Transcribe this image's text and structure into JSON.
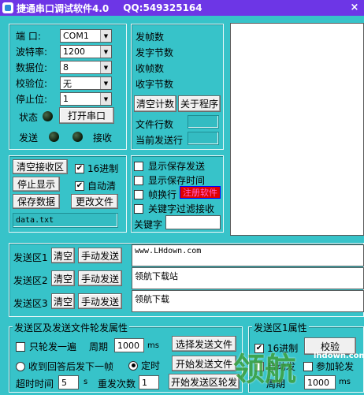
{
  "title": {
    "app_name": "捷通串口调试软件4.0",
    "qq": "QQ:549325164",
    "close_glyph": "×"
  },
  "port": {
    "port_label": "端    口:",
    "port_value": "COM1",
    "baud_label": "波特率:",
    "baud_value": "1200",
    "databits_label": "数据位:",
    "databits_value": "8",
    "parity_label": "校验位:",
    "parity_value": "无",
    "stopbits_label": "停止位:",
    "stopbits_value": "1",
    "status_label": "状态",
    "open_button": "打开串口",
    "send_label": "发送",
    "recv_label": "接收"
  },
  "stats": {
    "send_frames": "发帧数",
    "send_bytes": "发字节数",
    "recv_frames": "收帧数",
    "recv_bytes": "收字节数",
    "clear_count_button": "清空计数",
    "about_button": "关于程序",
    "file_lines_label": "文件行数",
    "current_line_label": "当前发送行"
  },
  "receive": {
    "clear_button": "清空接收区",
    "hex_label": "16进制",
    "hex_checked": true,
    "stop_display_button": "停止显示",
    "auto_clear_label": "自动清",
    "auto_clear_checked": true,
    "save_data_button": "保存数据",
    "change_file_button": "更改文件",
    "file_name": "data.txt"
  },
  "options": {
    "show_save_send": "显示保存发送",
    "show_save_time": "显示保存时间",
    "frame_newline": "帧换行",
    "register_button": "注册软件",
    "keyword_filter": "关键字过滤接收",
    "keyword_label": "关键字",
    "keyword_value": ""
  },
  "send_areas": [
    {
      "label": "发送区1",
      "clear": "清空",
      "manual": "手动发送",
      "content": "www.LHdown.com"
    },
    {
      "label": "发送区2",
      "clear": "清空",
      "manual": "手动发送",
      "content": "领航下载站"
    },
    {
      "label": "发送区3",
      "clear": "清空",
      "manual": "手动发送",
      "content": "领航下载"
    }
  ],
  "rotation": {
    "group_title": "发送区及发送文件轮发属性",
    "single_round": "只轮发一遍",
    "period_label": "周期",
    "period_value": "1000",
    "period_unit": "ms",
    "select_file_button": "选择发送文件",
    "recv_reply_next": "收到回答后发下一帧",
    "timed": "定时",
    "start_file_button": "开始发送文件",
    "timeout_label": "超时时间",
    "timeout_value": "5",
    "timeout_unit": "s",
    "resend_label": "重发次数",
    "resend_value": "1",
    "start_rotation_button": "开始发送区轮发"
  },
  "area1_props": {
    "group_title": "发送区1属性",
    "hex_label": "16进制",
    "hex_checked": true,
    "checksum_button": "校验",
    "auto_send_label": "自动发",
    "param_label": "参加轮发",
    "period_label": "周期",
    "period_value": "1000",
    "period_unit": "ms"
  },
  "watermark": {
    "text": "领航",
    "site": "lhdown.com"
  },
  "colors": {
    "background": "#37c3c9",
    "title_bar": "#6d36e6",
    "register_bg": "#e00000"
  }
}
